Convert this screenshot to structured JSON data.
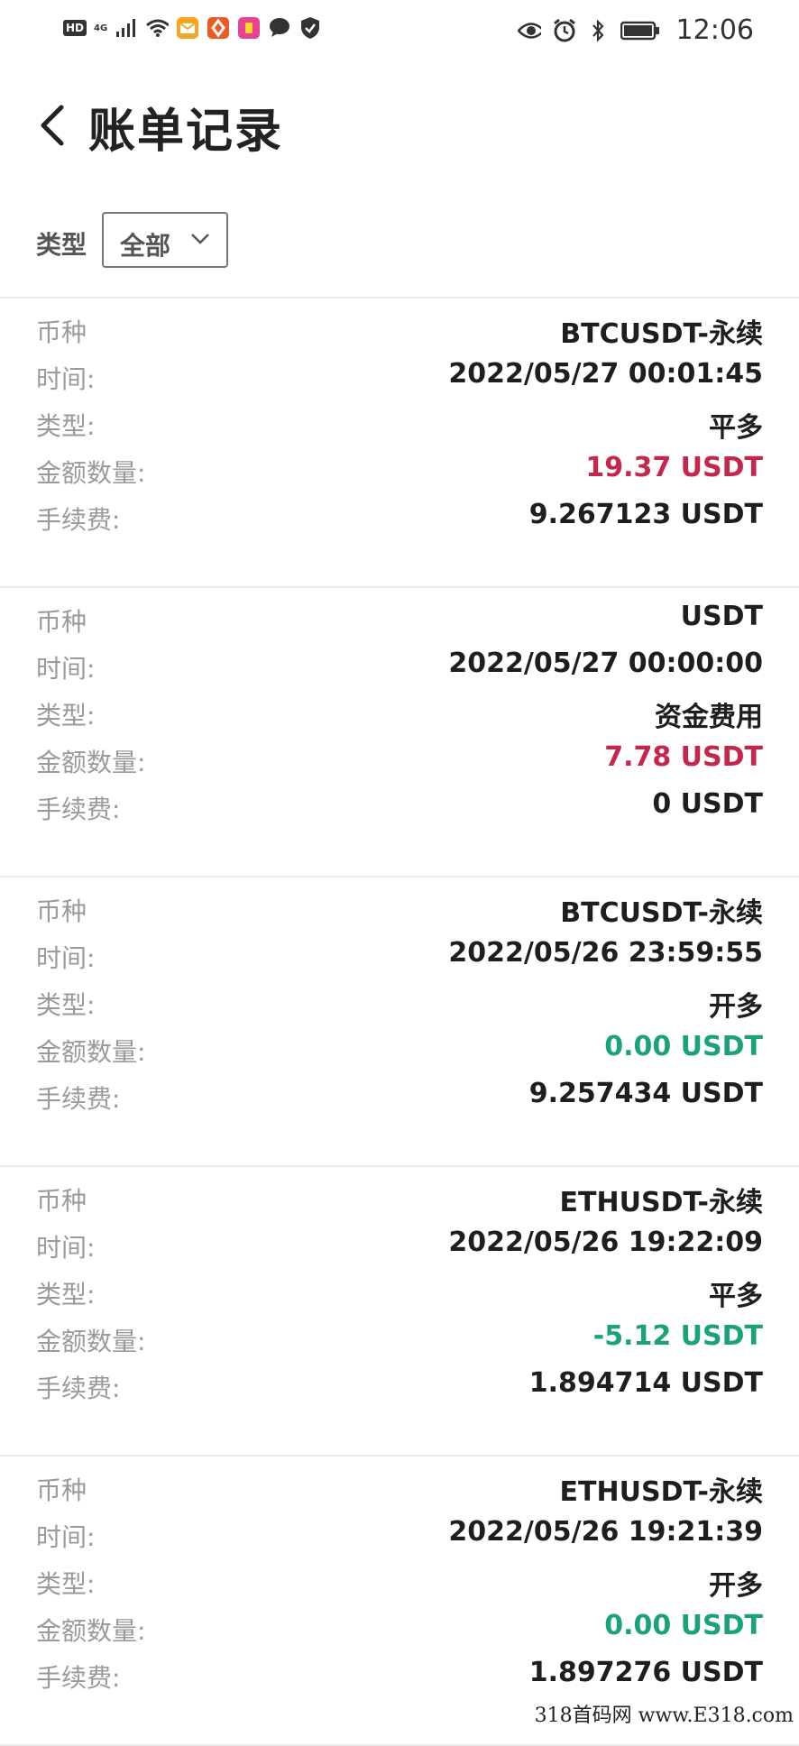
{
  "status": {
    "time": "12:06",
    "network": "4G",
    "hd": "HD"
  },
  "header": {
    "title": "账单记录"
  },
  "filter": {
    "label": "类型",
    "selected": "全部"
  },
  "labels": {
    "coin": "币种",
    "time": "时间:",
    "type": "类型:",
    "amount": "金额数量:",
    "fee": "手续费:"
  },
  "records": [
    {
      "coin": "BTCUSDT-永续",
      "time": "2022/05/27 00:01:45",
      "type": "平多",
      "amount": "19.37 USDT",
      "amount_sign": "pos",
      "fee": "9.267123 USDT"
    },
    {
      "coin": "USDT",
      "time": "2022/05/27 00:00:00",
      "type": "资金费用",
      "amount": "7.78 USDT",
      "amount_sign": "pos",
      "fee": "0 USDT"
    },
    {
      "coin": "BTCUSDT-永续",
      "time": "2022/05/26 23:59:55",
      "type": "开多",
      "amount": "0.00 USDT",
      "amount_sign": "neg",
      "fee": "9.257434 USDT"
    },
    {
      "coin": "ETHUSDT-永续",
      "time": "2022/05/26 19:22:09",
      "type": "平多",
      "amount": "-5.12 USDT",
      "amount_sign": "neg",
      "fee": "1.894714 USDT"
    },
    {
      "coin": "ETHUSDT-永续",
      "time": "2022/05/26 19:21:39",
      "type": "开多",
      "amount": "0.00 USDT",
      "amount_sign": "neg",
      "fee": "1.897276 USDT"
    }
  ],
  "colors": {
    "positive": "#c5264b",
    "negative": "#1aa37a"
  },
  "watermark": "318首码网 www.E318.com"
}
